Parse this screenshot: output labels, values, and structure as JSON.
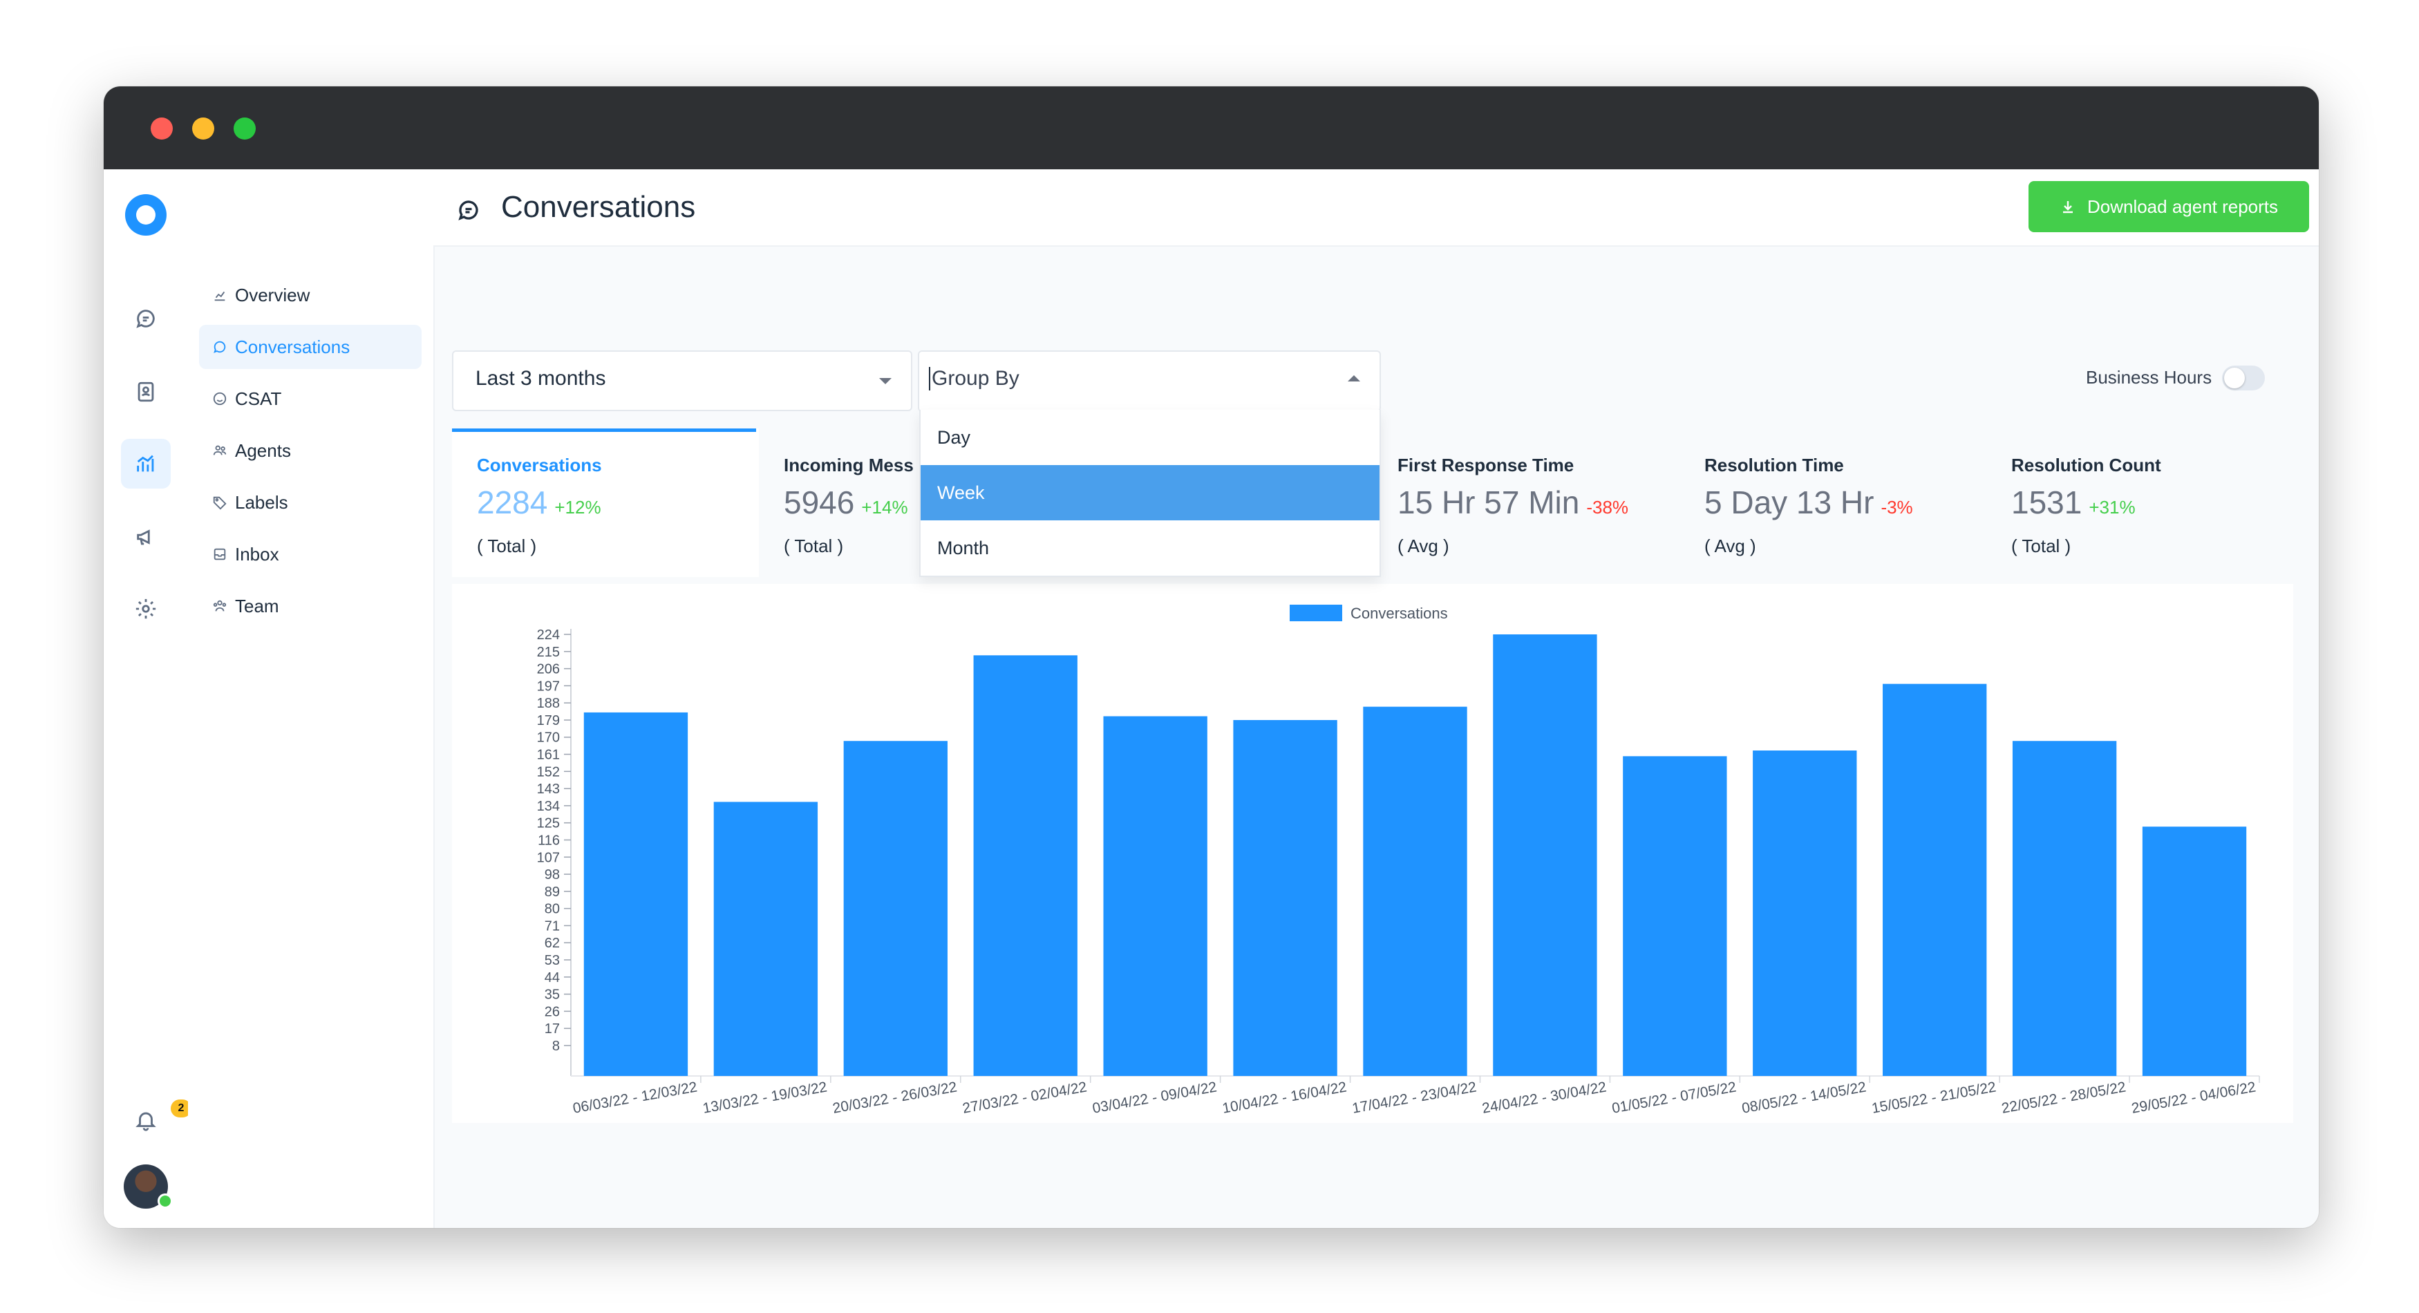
{
  "window": {
    "controls": [
      "close",
      "minimize",
      "maximize"
    ]
  },
  "rail": {
    "logo": "chatwoot-logo",
    "items": [
      {
        "icon": "chat-icon"
      },
      {
        "icon": "contacts-icon"
      },
      {
        "icon": "reports-icon",
        "active": true
      },
      {
        "icon": "campaigns-icon"
      },
      {
        "icon": "settings-icon"
      }
    ],
    "notifications": {
      "icon": "bell-icon",
      "count": "2"
    }
  },
  "subnav": {
    "items": [
      {
        "label": "Overview",
        "icon": "chart-line-icon"
      },
      {
        "label": "Conversations",
        "icon": "chat-icon",
        "active": true
      },
      {
        "label": "CSAT",
        "icon": "smile-icon"
      },
      {
        "label": "Agents",
        "icon": "people-icon"
      },
      {
        "label": "Labels",
        "icon": "tag-icon"
      },
      {
        "label": "Inbox",
        "icon": "inbox-icon"
      },
      {
        "label": "Team",
        "icon": "team-icon"
      }
    ]
  },
  "header": {
    "title": "Conversations",
    "download_label": "Download agent reports"
  },
  "filters": {
    "range": "Last 3 months",
    "group_by_placeholder": "Group By",
    "group_by_options": [
      "Day",
      "Week",
      "Month"
    ],
    "group_by_selected": "Week",
    "business_hours_label": "Business Hours",
    "business_hours_on": false
  },
  "metrics": [
    {
      "label": "Conversations",
      "value": "2284",
      "delta": "+12%",
      "sub": "( Total )",
      "active": true
    },
    {
      "label": "Incoming Mess",
      "value": "5946",
      "delta": "+14%",
      "sub": "( Total )"
    },
    {
      "label": "",
      "value": "",
      "delta": "",
      "sub": ""
    },
    {
      "label": "First Response Time",
      "value": "15 Hr 57 Min",
      "delta": "-38%",
      "sub": "( Avg )"
    },
    {
      "label": "Resolution Time",
      "value": "5 Day 13 Hr",
      "delta": "-3%",
      "sub": "( Avg )"
    },
    {
      "label": "Resolution Count",
      "value": "1531",
      "delta": "+31%",
      "sub": "( Total )"
    }
  ],
  "chart_data": {
    "type": "bar",
    "legend": [
      "Conversations"
    ],
    "legend_position": "top",
    "color": "#1f93ff",
    "categories": [
      "06/03/22 - 12/03/22",
      "13/03/22 - 19/03/22",
      "20/03/22 - 26/03/22",
      "27/03/22 - 02/04/22",
      "03/04/22 - 09/04/22",
      "10/04/22 - 16/04/22",
      "17/04/22 - 23/04/22",
      "24/04/22 - 30/04/22",
      "01/05/22 - 07/05/22",
      "08/05/22 - 14/05/22",
      "15/05/22 - 21/05/22",
      "22/05/22 - 28/05/22",
      "29/05/22 - 04/06/22"
    ],
    "series": [
      {
        "name": "Conversations",
        "values": [
          183,
          136,
          168,
          213,
          181,
          179,
          186,
          224,
          160,
          163,
          198,
          168,
          123
        ]
      }
    ],
    "yticks": [
      "224",
      "215",
      "206",
      "197",
      "188",
      "179",
      "170",
      "161",
      "152",
      "143",
      "134",
      "125",
      "116",
      "107",
      "98",
      "89",
      "80",
      "71",
      "62",
      "53",
      "44",
      "35",
      "26",
      "17",
      "8"
    ],
    "ylim": [
      0,
      224
    ],
    "grid": false
  }
}
